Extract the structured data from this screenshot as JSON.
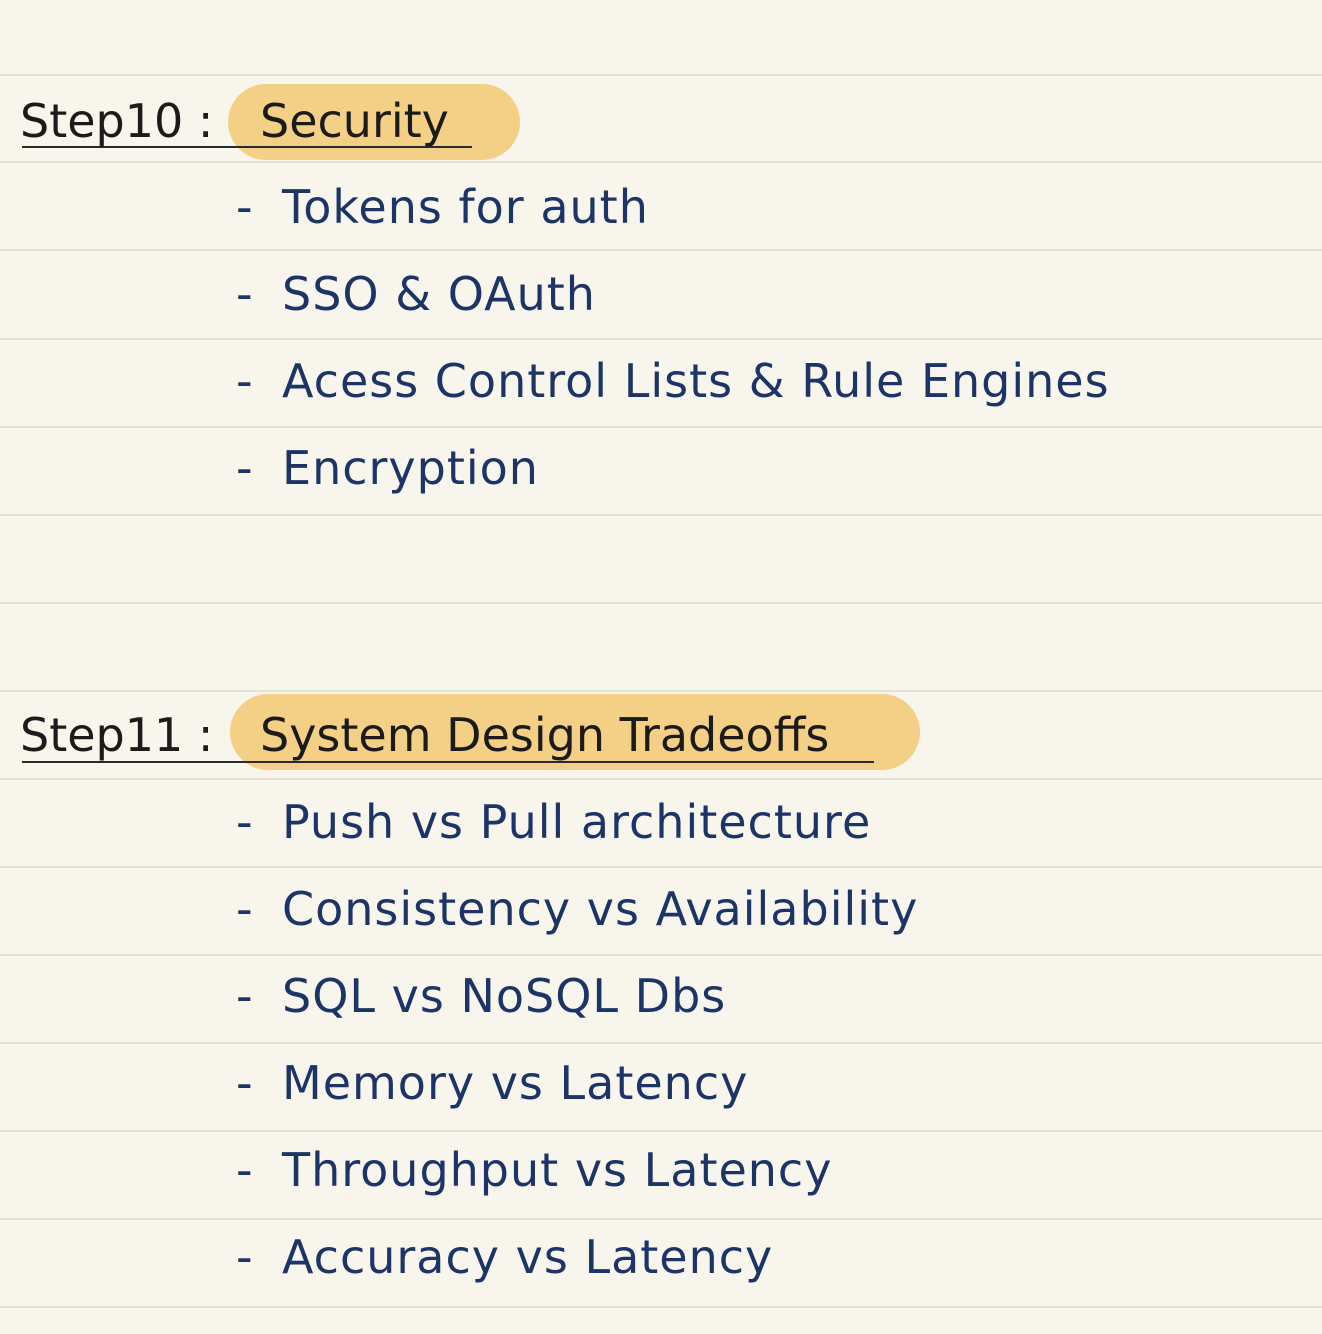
{
  "sections": [
    {
      "step": "Step10 :",
      "topic": "Security",
      "items": [
        "Tokens for auth",
        "SSO & OAuth",
        "Acess Control Lists & Rule Engines",
        "Encryption"
      ]
    },
    {
      "step": "Step11 :",
      "topic": "System Design Tradeoffs",
      "items": [
        "Push vs Pull architecture",
        "Consistency vs Availability",
        "SQL vs NoSQL Dbs",
        "Memory vs Latency",
        "Throughput vs Latency",
        "Accuracy vs Latency"
      ]
    }
  ],
  "bullet": "-",
  "colors": {
    "paper": "#f8f5ec",
    "rule_line": "#e4e1d8",
    "highlight": "#f3cd82",
    "heading_text": "#1b1b1b",
    "item_text": "#1d3466"
  }
}
